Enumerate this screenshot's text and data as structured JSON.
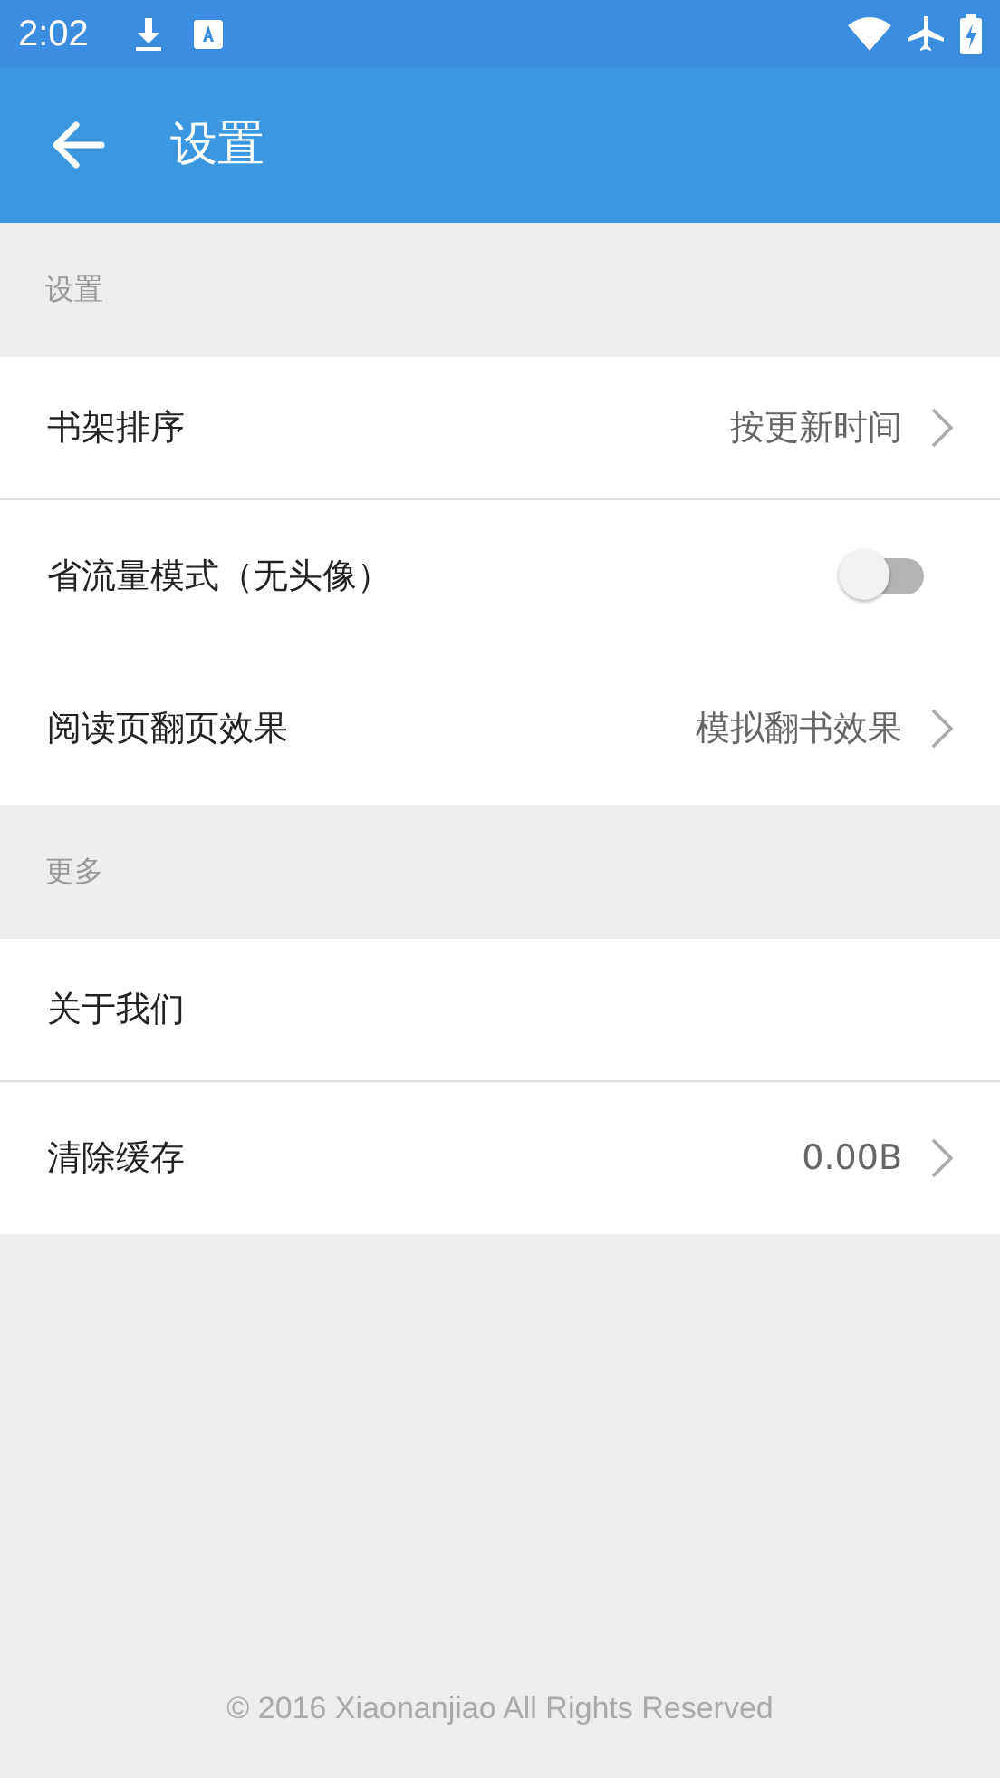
{
  "status_bar": {
    "time": "2:02"
  },
  "app_bar": {
    "title": "设置"
  },
  "sections": [
    {
      "header": "设置",
      "items": [
        {
          "kind": "link",
          "label": "书架排序",
          "value": "按更新时间",
          "divider": true
        },
        {
          "kind": "toggle",
          "label": "省流量模式（无头像）",
          "on": false,
          "divider": false
        },
        {
          "kind": "link",
          "label": "阅读页翻页效果",
          "value": "模拟翻书效果",
          "divider": false
        }
      ]
    },
    {
      "header": "更多",
      "items": [
        {
          "kind": "plain",
          "label": "关于我们",
          "divider": true
        },
        {
          "kind": "link",
          "label": "清除缓存",
          "value": "0.00B",
          "divider": false
        }
      ]
    }
  ],
  "footer": "© 2016 Xiaonanjiao All Rights Reserved"
}
